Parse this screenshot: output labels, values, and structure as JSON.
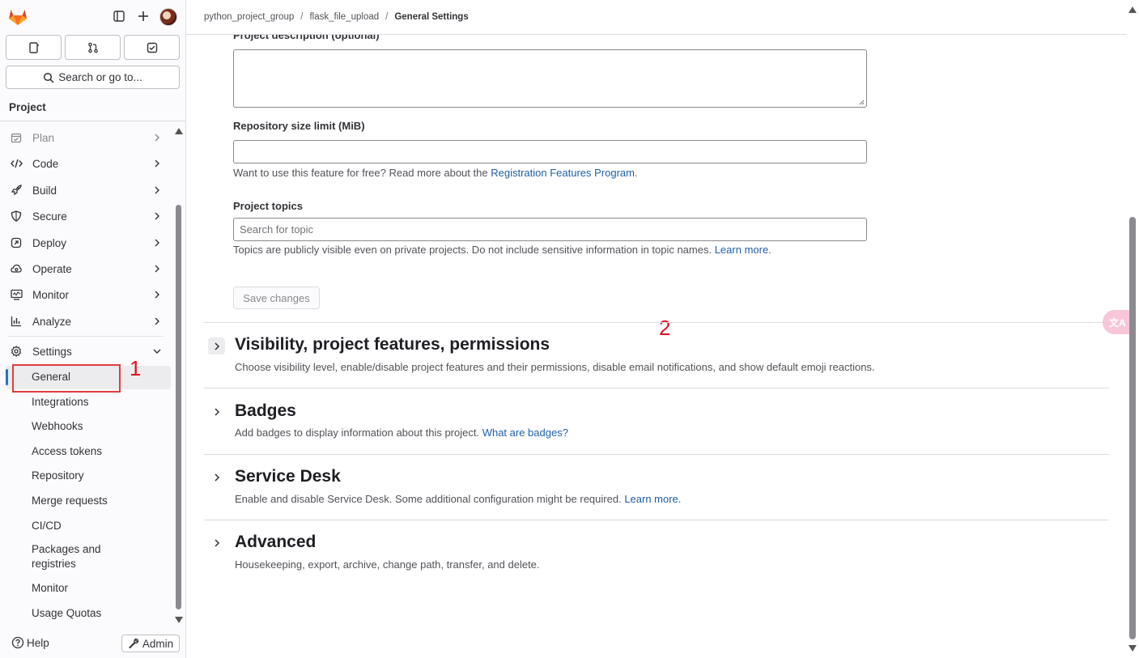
{
  "header": {
    "breadcrumbs": [
      "python_project_group",
      "flask_file_upload",
      "General Settings"
    ]
  },
  "sidebar": {
    "search_label": "Search or go to...",
    "section": "Project",
    "items": [
      {
        "label": "Plan",
        "icon": "plan-icon"
      },
      {
        "label": "Code",
        "icon": "code-icon"
      },
      {
        "label": "Build",
        "icon": "rocket-icon"
      },
      {
        "label": "Secure",
        "icon": "shield-icon"
      },
      {
        "label": "Deploy",
        "icon": "deploy-icon"
      },
      {
        "label": "Operate",
        "icon": "cloud-gear-icon"
      },
      {
        "label": "Monitor",
        "icon": "monitor-icon"
      },
      {
        "label": "Analyze",
        "icon": "chart-icon"
      }
    ],
    "settings_label": "Settings",
    "settings_subitems": [
      "General",
      "Integrations",
      "Webhooks",
      "Access tokens",
      "Repository",
      "Merge requests",
      "CI/CD",
      "Packages and",
      "registries",
      "Monitor",
      "Usage Quotas"
    ],
    "help_label": "Help",
    "admin_label": "Admin"
  },
  "form": {
    "description_label": "Project description (optional)",
    "description_value": "",
    "size_limit_label": "Repository size limit (MiB)",
    "size_limit_value": "",
    "size_help_prefix": "Want to use this feature for free? Read more about the",
    "size_help_link": "Registration Features Program",
    "size_help_suffix": ".",
    "topics_label": "Project topics",
    "topics_placeholder": "Search for topic",
    "topics_help": "Topics are publicly visible even on private projects. Do not include sensitive information in topic names.",
    "topics_help_link": "Learn more.",
    "save_label": "Save changes"
  },
  "sections": [
    {
      "title": "Visibility, project features, permissions",
      "desc": "Choose visibility level, enable/disable project features and their permissions, disable email notifications, and show default emoji reactions.",
      "link": ""
    },
    {
      "title": "Badges",
      "desc": "Add badges to display information about this project.",
      "link": "What are badges?"
    },
    {
      "title": "Service Desk",
      "desc": "Enable and disable Service Desk. Some additional configuration might be required.",
      "link": "Learn more."
    },
    {
      "title": "Advanced",
      "desc": "Housekeeping, export, archive, change path, transfer, and delete.",
      "link": ""
    }
  ],
  "annotations": {
    "one": "1",
    "two": "2"
  },
  "translate_icon_label": "文A",
  "colors": {
    "accent": "#1f75cb",
    "link": "#1f5fa8",
    "annotation": "#e0101e"
  }
}
